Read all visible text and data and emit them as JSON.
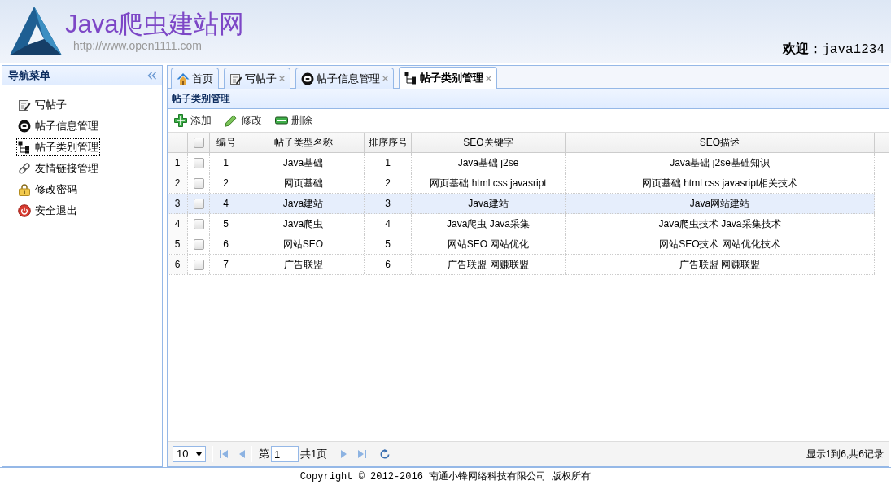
{
  "header": {
    "title": "Java爬虫建站网",
    "url": "http://www.open1111.com",
    "welcome": "欢迎：",
    "username": "java1234"
  },
  "sidebar": {
    "title": "导航菜单",
    "items": [
      {
        "kind": "write",
        "label": "写帖子",
        "selected": false
      },
      {
        "kind": "info",
        "label": "帖子信息管理",
        "selected": false
      },
      {
        "kind": "category",
        "label": "帖子类别管理",
        "selected": true
      },
      {
        "kind": "link",
        "label": "友情链接管理",
        "selected": false
      },
      {
        "kind": "password",
        "label": "修改密码",
        "selected": false
      },
      {
        "kind": "logout",
        "label": "安全退出",
        "selected": false
      }
    ]
  },
  "tabs": [
    {
      "kind": "home",
      "label": "首页",
      "closable": false,
      "selected": false
    },
    {
      "kind": "write",
      "label": "写帖子",
      "closable": true,
      "selected": false
    },
    {
      "kind": "info",
      "label": "帖子信息管理",
      "closable": true,
      "selected": false
    },
    {
      "kind": "category",
      "label": "帖子类别管理",
      "closable": true,
      "selected": true
    }
  ],
  "panel": {
    "title": "帖子类别管理",
    "toolbar": [
      {
        "kind": "add",
        "label": "添加"
      },
      {
        "kind": "edit",
        "label": "修改"
      },
      {
        "kind": "delete",
        "label": "删除"
      }
    ],
    "table": {
      "all_checked": false,
      "columns": [
        "编号",
        "帖子类型名称",
        "排序序号",
        "SEO关键字",
        "SEO描述"
      ],
      "rows": [
        {
          "number": "1",
          "checked": false,
          "selected": false,
          "cells": [
            "1",
            "Java基础",
            "1",
            "Java基础 j2se",
            "Java基础 j2se基础知识"
          ]
        },
        {
          "number": "2",
          "checked": false,
          "selected": false,
          "cells": [
            "2",
            "网页基础",
            "2",
            "网页基础 html css javasript",
            "网页基础 html css javasript相关技术"
          ]
        },
        {
          "number": "3",
          "checked": false,
          "selected": true,
          "cells": [
            "4",
            "Java建站",
            "3",
            "Java建站",
            "Java网站建站"
          ]
        },
        {
          "number": "4",
          "checked": false,
          "selected": false,
          "cells": [
            "5",
            "Java爬虫",
            "4",
            "Java爬虫 Java采集",
            "Java爬虫技术 Java采集技术"
          ]
        },
        {
          "number": "5",
          "checked": false,
          "selected": false,
          "cells": [
            "6",
            "网站SEO",
            "5",
            "网站SEO 网站优化",
            "网站SEO技术 网站优化技术"
          ]
        },
        {
          "number": "6",
          "checked": false,
          "selected": false,
          "cells": [
            "7",
            "广告联盟",
            "6",
            "广告联盟 网赚联盟",
            "广告联盟 网赚联盟"
          ]
        }
      ]
    },
    "pager": {
      "page_size": "10",
      "page_prefix": "第",
      "page": "1",
      "page_count": "共1页",
      "summary": "显示1到6,共6记录"
    }
  },
  "footer": {
    "copyright": "Copyright © 2012-2016 南通小锋网络科技有限公司 版权所有"
  }
}
